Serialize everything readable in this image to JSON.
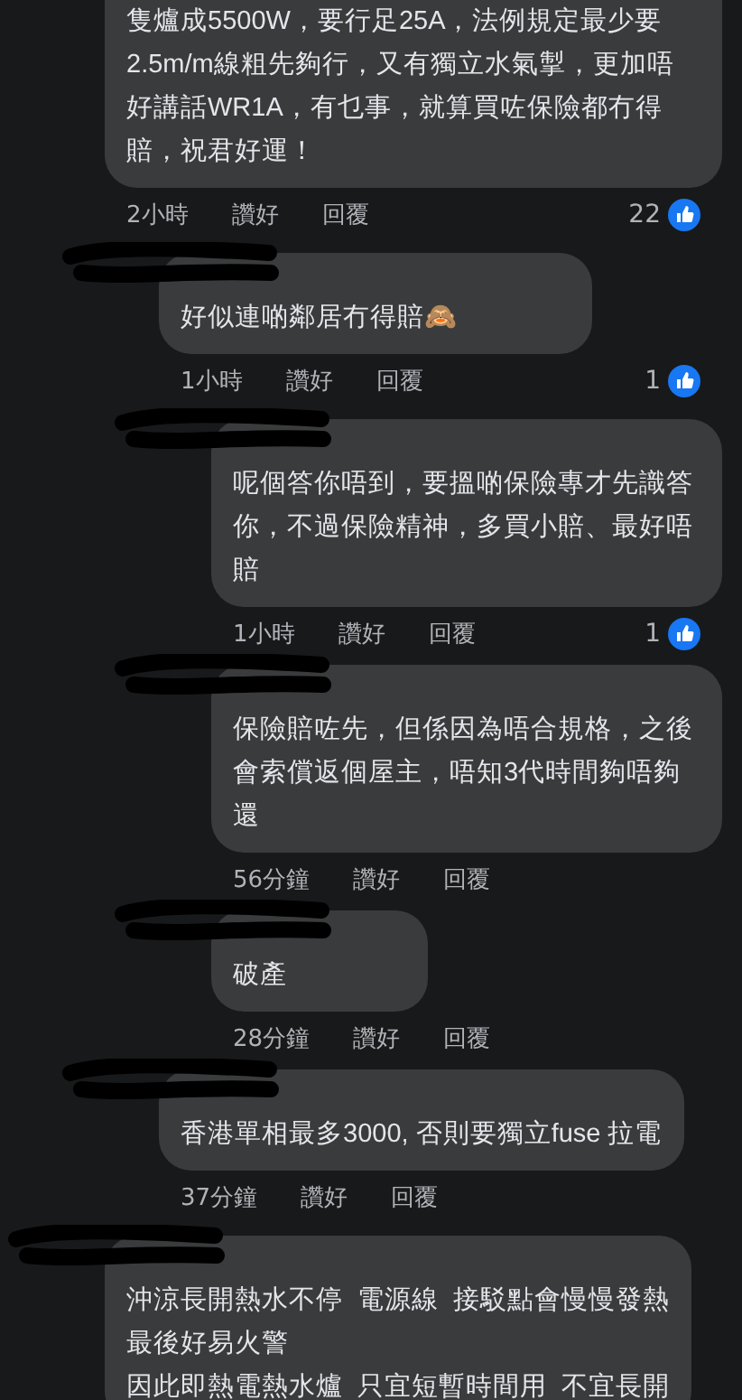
{
  "comments": [
    {
      "text": "隻爐成5500W，要行足25A，法例規定最少要2.5m/m線粗先夠行，又有獨立水氣掣，更加唔好講話WR1A，有乜事，就算買咗保險都冇得賠，祝君好運！",
      "time": "2小時",
      "like": "讚好",
      "reply": "回覆",
      "reactions": "22",
      "cut_top": true,
      "children": [
        {
          "text": "好似連啲鄰居冇得賠🙈",
          "time": "1小時",
          "like": "讚好",
          "reply": "回覆",
          "reactions": "1",
          "children": [
            {
              "text": "呢個答你唔到，要搵啲保險專才先識答你，不過保險精神，多買小賠、最好唔賠",
              "time": "1小時",
              "like": "讚好",
              "reply": "回覆",
              "reactions": "1"
            },
            {
              "text": "保險賠咗先，但係因為唔合規格，之後會索償返個屋主，唔知3代時間夠唔夠還",
              "time": "56分鐘",
              "like": "讚好",
              "reply": "回覆"
            },
            {
              "text": "破產",
              "time": "28分鐘",
              "like": "讚好",
              "reply": "回覆"
            }
          ]
        },
        {
          "text": "香港單相最多3000, 否則要獨立fuse 拉電",
          "time": "37分鐘",
          "like": "讚好",
          "reply": "回覆"
        }
      ]
    },
    {
      "lines": [
        "沖涼長開熱水不停  電源線  接駁點會慢慢發熱",
        "最後好易火警",
        "因此即熱電熱水爐  只宜短暫時間用  不宜長開"
      ]
    }
  ]
}
